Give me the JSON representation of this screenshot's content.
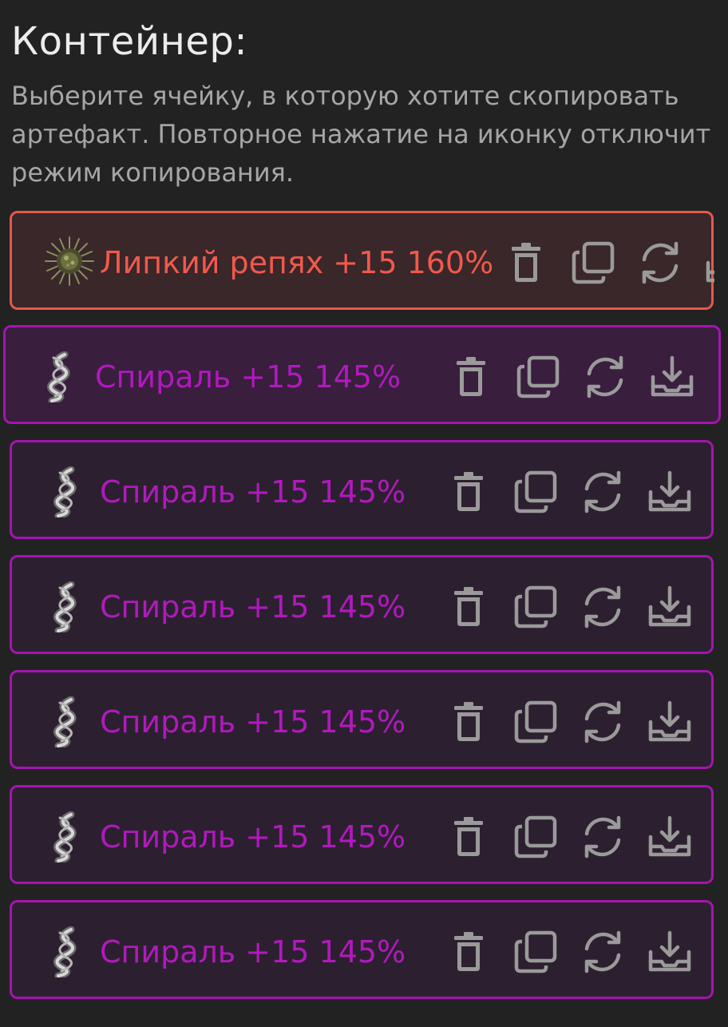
{
  "header": {
    "title": "Контейнер:",
    "description": "Выберите ячейку, в которую хотите скопировать артефакт. Повторное нажатие на иконку отключит режим копирования."
  },
  "slots": [
    {
      "name": "Липкий репях +15 160%",
      "icon": "burdock-artifact-icon",
      "state": "selected"
    },
    {
      "name": "Спираль +15 145%",
      "icon": "spiral-artifact-icon",
      "state": "active"
    },
    {
      "name": "Спираль +15 145%",
      "icon": "spiral-artifact-icon",
      "state": "normal"
    },
    {
      "name": "Спираль +15 145%",
      "icon": "spiral-artifact-icon",
      "state": "normal"
    },
    {
      "name": "Спираль +15 145%",
      "icon": "spiral-artifact-icon",
      "state": "normal"
    },
    {
      "name": "Спираль +15 145%",
      "icon": "spiral-artifact-icon",
      "state": "normal"
    },
    {
      "name": "Спираль +15 145%",
      "icon": "spiral-artifact-icon",
      "state": "normal"
    }
  ],
  "actions": [
    "trash-icon",
    "copy-icon",
    "swap-icon",
    "download-icon"
  ],
  "colors": {
    "background": "#222222",
    "slot_border": "#a514b0",
    "slot_name": "#b119bd",
    "selected_border": "#e4594d",
    "selected_name": "#f2594b",
    "icon_gray": "#9a9a9a"
  }
}
